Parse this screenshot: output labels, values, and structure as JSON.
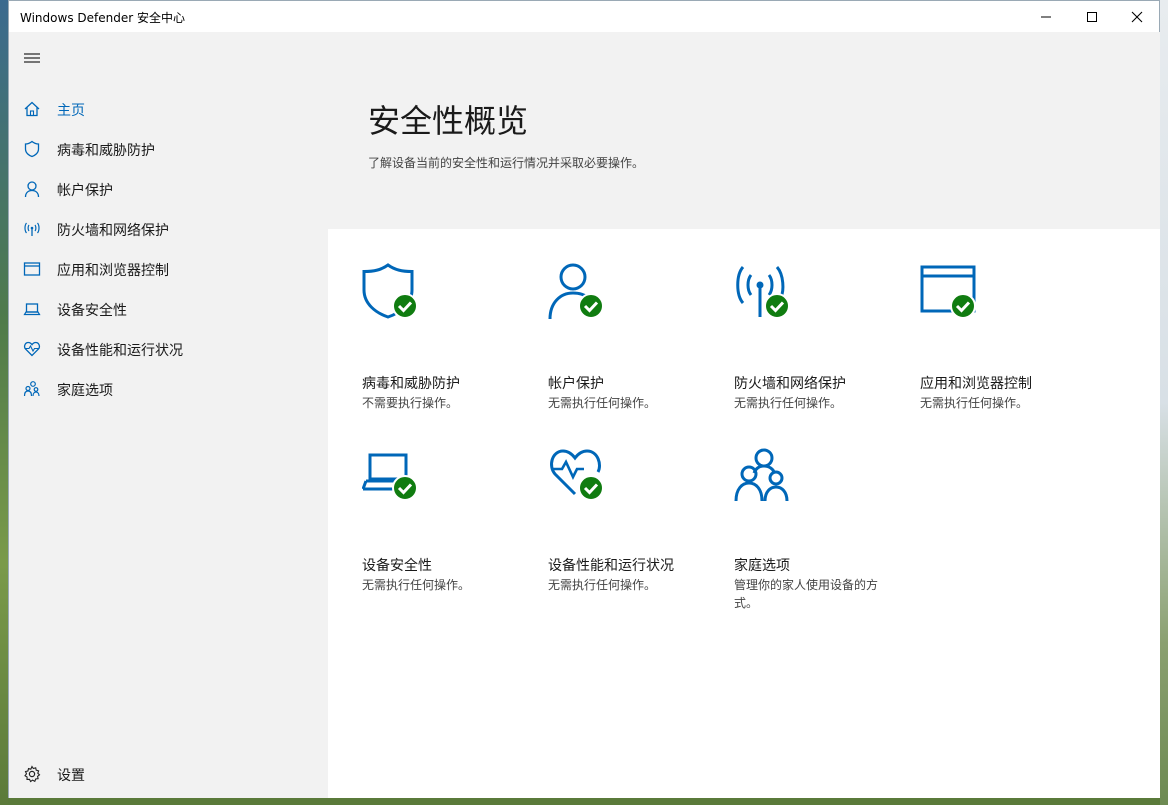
{
  "window": {
    "title": "Windows Defender 安全中心"
  },
  "sidebar": {
    "items": [
      {
        "label": "主页",
        "icon": "home-icon",
        "active": true
      },
      {
        "label": "病毒和威胁防护",
        "icon": "shield-icon"
      },
      {
        "label": "帐户保护",
        "icon": "person-icon"
      },
      {
        "label": "防火墙和网络保护",
        "icon": "antenna-icon"
      },
      {
        "label": "应用和浏览器控制",
        "icon": "browser-window-icon"
      },
      {
        "label": "设备安全性",
        "icon": "laptop-icon"
      },
      {
        "label": "设备性能和运行状况",
        "icon": "heart-icon"
      },
      {
        "label": "家庭选项",
        "icon": "family-icon"
      }
    ],
    "settings_label": "设置"
  },
  "main": {
    "title": "安全性概览",
    "subtitle": "了解设备当前的安全性和运行情况并采取必要操作。",
    "tiles": [
      {
        "name": "病毒和威胁防护",
        "desc": "不需要执行操作。",
        "icon": "shield-check-icon"
      },
      {
        "name": "帐户保护",
        "desc": "无需执行任何操作。",
        "icon": "person-check-icon"
      },
      {
        "name": "防火墙和网络保护",
        "desc": "无需执行任何操作。",
        "icon": "antenna-check-icon"
      },
      {
        "name": "应用和浏览器控制",
        "desc": "无需执行任何操作。",
        "icon": "browser-check-icon"
      },
      {
        "name": "设备安全性",
        "desc": "无需执行任何操作。",
        "icon": "laptop-check-icon"
      },
      {
        "name": "设备性能和运行状况",
        "desc": "无需执行任何操作。",
        "icon": "heart-check-icon"
      },
      {
        "name": "家庭选项",
        "desc": "管理你的家人使用设备的方式。",
        "icon": "family-icon"
      }
    ]
  },
  "colors": {
    "accent": "#0067b8",
    "ok_green": "#107c10",
    "sidebar_bg": "#f2f2f2",
    "content_bg": "#ffffff"
  }
}
